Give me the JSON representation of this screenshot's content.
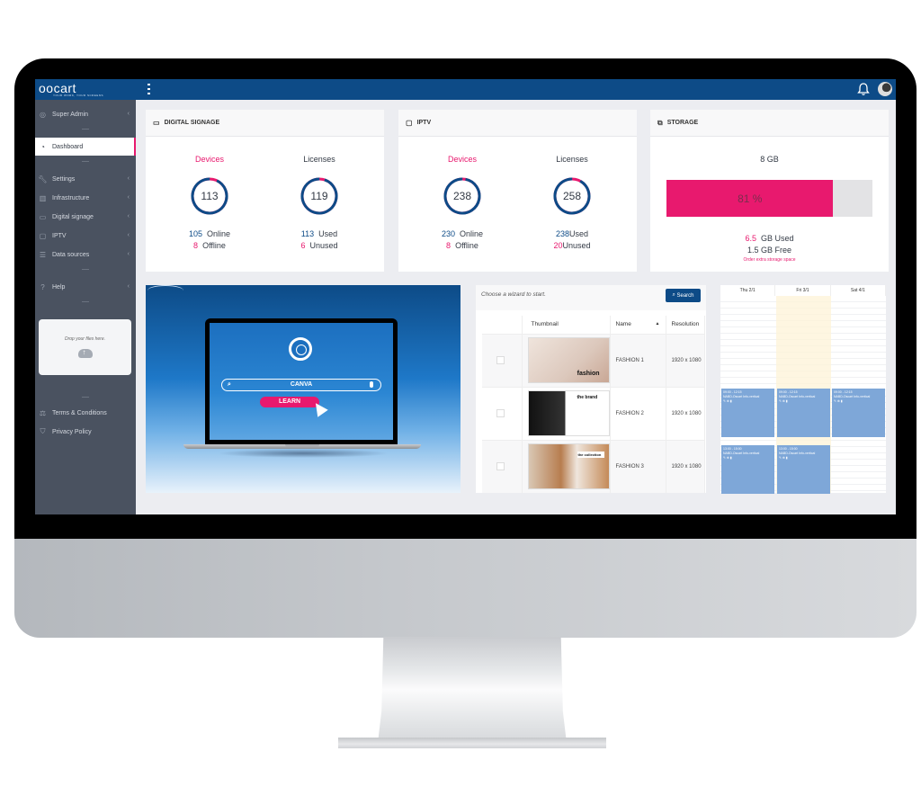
{
  "app": {
    "logo_text": "oocart",
    "logo_tagline": "YOUR WORK, YOUR SCREENS"
  },
  "topbar": {
    "menu_icon": "vertical-dots-icon",
    "notifications_icon": "bell-icon",
    "avatar_icon": "user-avatar"
  },
  "sidebar": {
    "user": {
      "label": "Super Admin",
      "icon": "eye-slash-icon"
    },
    "items": [
      {
        "label": "Dashboard",
        "icon": "dashboard-gauge-icon",
        "active": true
      },
      {
        "label": "Settings",
        "icon": "wrench-icon"
      },
      {
        "label": "Infrastructure",
        "icon": "building-icon"
      },
      {
        "label": "Digital signage",
        "icon": "monitor-icon"
      },
      {
        "label": "IPTV",
        "icon": "tv-icon"
      },
      {
        "label": "Data sources",
        "icon": "database-icon"
      },
      {
        "label": "Help",
        "icon": "question-icon"
      }
    ],
    "dropzone": {
      "text": "Drop your files here.",
      "icon": "cloud-upload-icon"
    },
    "footer": [
      {
        "label": "Terms & Conditions",
        "icon": "scales-icon"
      },
      {
        "label": "Privacy Policy",
        "icon": "shield-icon"
      }
    ]
  },
  "cards": {
    "digital_signage": {
      "title": "DIGITAL SIGNAGE",
      "devices": {
        "label": "Devices",
        "total": "113",
        "online": "105",
        "online_label": "Online",
        "offline": "8",
        "offline_label": "Offline",
        "fraction_online": 0.93
      },
      "licenses": {
        "label": "Licenses",
        "total": "119",
        "used": "113",
        "used_label": "Used",
        "unused": "6",
        "unused_label": "Unused",
        "fraction_used": 0.95
      }
    },
    "iptv": {
      "title": "IPTV",
      "devices": {
        "label": "Devices",
        "total": "238",
        "online": "230",
        "online_label": "Online",
        "offline": "8",
        "offline_label": "Offline",
        "fraction_online": 0.97
      },
      "licenses": {
        "label": "Licenses",
        "total": "258",
        "used": "238",
        "used_label": "Used",
        "unused": "20",
        "unused_label": "Unused",
        "fraction_used": 0.92
      }
    },
    "storage": {
      "title": "STORAGE",
      "total": "8 GB",
      "percent_label": "81 %",
      "percent_used": 81,
      "used_value": "6.5",
      "used_label": "GB Used",
      "free_label": "1.5 GB Free",
      "order_link": "Order extra storage space"
    }
  },
  "promo": {
    "search_text": "CANVA",
    "button_label": "LEARN"
  },
  "media": {
    "hint": "Choose a wizard to start.",
    "search_button": "Search",
    "columns": [
      "",
      "Thumbnail",
      "Name",
      "Resolution"
    ],
    "rows": [
      {
        "name": "FASHION 1",
        "resolution": "1920 x 1080",
        "thumb_caption": "fashion"
      },
      {
        "name": "FASHION 2",
        "resolution": "1920 x 1080",
        "thumb_caption": "the brand"
      },
      {
        "name": "FASHION 3",
        "resolution": "1920 x 1080",
        "thumb_caption": "the collection"
      }
    ]
  },
  "calendar": {
    "days": [
      "Thu 2/1",
      "Fri 3/1",
      "Sat 4/1"
    ],
    "events": [
      {
        "time": "09:00 - 12:15",
        "title": "NABD-Oscart Info-vertical"
      },
      {
        "time": "09:00 - 12:15",
        "title": "NABD-Oscart Info-vertical"
      },
      {
        "time": "09:00 - 12:15",
        "title": "NABD-Oscart Info-vertical"
      },
      {
        "time": "13:00 - 15:00",
        "title": "NABD-Oscart Info-vertical"
      },
      {
        "time": "13:00 - 15:00",
        "title": "NABD-Oscart Info-vertical"
      }
    ]
  },
  "colors": {
    "brand_blue": "#0d4b87",
    "accent_pink": "#e8196e",
    "sidebar_bg": "#4a5260",
    "event_blue": "#7ea7d8"
  }
}
